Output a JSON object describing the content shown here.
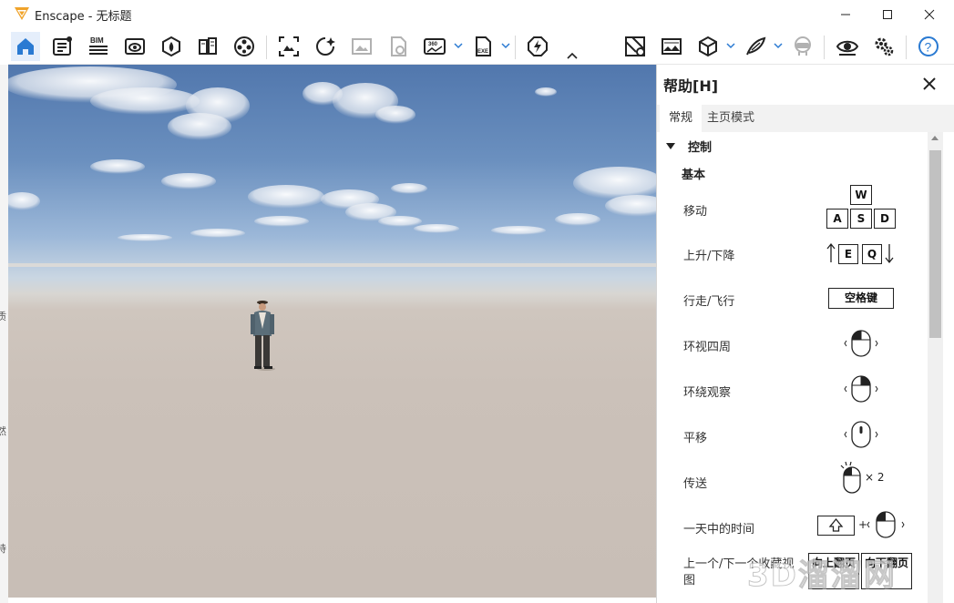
{
  "window": {
    "title": "Enscape - 无标题",
    "logo": "enscape-logo-icon",
    "controls": [
      "minimize-icon",
      "maximize-icon",
      "close-icon"
    ]
  },
  "toolbar": {
    "items": [
      {
        "name": "home-icon",
        "active": true
      },
      {
        "name": "notes-icon"
      },
      {
        "name": "bim-icon",
        "label": "BIM"
      },
      {
        "name": "view-icon"
      },
      {
        "name": "asset-library-icon"
      },
      {
        "name": "material-editor-icon"
      },
      {
        "name": "video-icon"
      },
      {
        "name": "screenshot-icon"
      },
      {
        "name": "batch-render-icon"
      },
      {
        "name": "image-export-icon",
        "dim": true
      },
      {
        "name": "web-standalone-icon",
        "dim": true
      },
      {
        "name": "panorama-icon",
        "label": "360"
      },
      {
        "name": "exe-export-icon",
        "label": "EXE"
      },
      {
        "name": "live-update-icon"
      },
      {
        "name": "map-view-icon"
      },
      {
        "name": "atmosphere-icon"
      },
      {
        "name": "cube-icon"
      },
      {
        "name": "feather-icon"
      },
      {
        "name": "vr-headset-icon",
        "dim": true
      },
      {
        "name": "eye-icon"
      },
      {
        "name": "settings-icon"
      },
      {
        "name": "help-icon",
        "label": "?"
      }
    ],
    "collapse_icon": "chevron-up-icon"
  },
  "left_strip_text": [
    "质",
    "然",
    "持"
  ],
  "help_panel": {
    "title": "帮助[H]",
    "tabs": [
      "常规",
      "主页模式"
    ],
    "section": "控制",
    "subsection": "基本",
    "rows": [
      {
        "label": "移动",
        "keys": [
          "W",
          "A",
          "S",
          "D"
        ]
      },
      {
        "label": "上升/下降",
        "keys": [
          "E",
          "Q"
        ]
      },
      {
        "label": "行走/飞行",
        "keys": [
          "空格键"
        ]
      },
      {
        "label": "环视四周",
        "control": "mouse-left-button-icon"
      },
      {
        "label": "环绕观察",
        "control": "mouse-right-button-icon"
      },
      {
        "label": "平移",
        "control": "mouse-middle-button-icon"
      },
      {
        "label": "传送",
        "control": "mouse-double-click-icon",
        "suffix": "× 2"
      },
      {
        "label": "一天中的时间",
        "control": "shift-key-icon",
        "plus": "+"
      },
      {
        "label": "上一个/下一个收藏视图",
        "keys": [
          "向上翻页",
          "向下翻页"
        ]
      }
    ]
  },
  "watermark": "3D溜溜网"
}
